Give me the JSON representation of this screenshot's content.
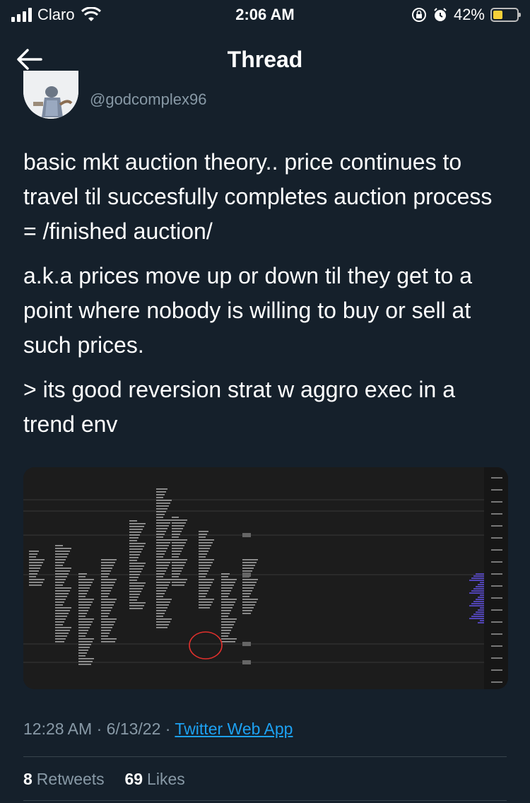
{
  "status_bar": {
    "carrier": "Claro",
    "time": "2:06 AM",
    "battery_percent": "42%",
    "battery_level": 0.42
  },
  "header": {
    "title": "Thread"
  },
  "tweet": {
    "handle": "@godcomplex96",
    "paragraphs": [
      "basic mkt auction theory.. price continues to travel til succesfully completes auction process = /finished auction/",
      "a.k.a prices move up or down til they get to a point where nobody is willing to buy or sell at such prices.",
      "> its good reversion strat w aggro exec in a trend env"
    ],
    "time": "12:28 AM",
    "date": "6/13/22",
    "source": "Twitter Web App",
    "retweets_count": "8",
    "retweets_label": "Retweets",
    "likes_count": "69",
    "likes_label": "Likes"
  },
  "colors": {
    "background": "#15202b",
    "muted": "#8899a6",
    "link": "#1da1f2",
    "battery": "#f7d038",
    "chart_circle": "#e0302c"
  },
  "icons": {
    "back": "arrow-left-icon",
    "wifi": "wifi-icon",
    "lock": "rotation-lock-icon",
    "alarm": "alarm-icon"
  }
}
